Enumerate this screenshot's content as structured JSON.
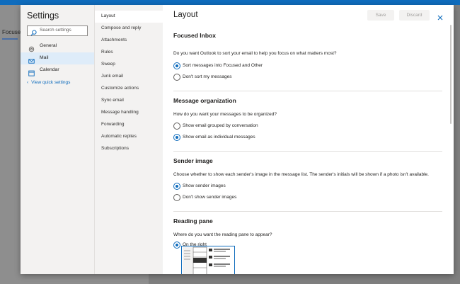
{
  "background": {
    "focused_label": "Focused"
  },
  "dialog": {
    "title": "Settings",
    "search": {
      "placeholder": "Search settings"
    },
    "categories": [
      {
        "label": "General",
        "icon": "gear-icon"
      },
      {
        "label": "Mail",
        "icon": "mail-icon",
        "selected": true
      },
      {
        "label": "Calendar",
        "icon": "calendar-icon"
      }
    ],
    "view_quick_settings": "View quick settings",
    "subnav": [
      {
        "label": "Layout",
        "selected": true
      },
      {
        "label": "Compose and reply"
      },
      {
        "label": "Attachments"
      },
      {
        "label": "Rules"
      },
      {
        "label": "Sweep"
      },
      {
        "label": "Junk email"
      },
      {
        "label": "Customize actions"
      },
      {
        "label": "Sync email"
      },
      {
        "label": "Message handling"
      },
      {
        "label": "Forwarding"
      },
      {
        "label": "Automatic replies"
      },
      {
        "label": "Subscriptions"
      }
    ],
    "pane": {
      "title": "Layout",
      "save_label": "Save",
      "discard_label": "Discard",
      "sections": [
        {
          "heading": "Focused Inbox",
          "question": "Do you want Outlook to sort your email to help you focus on what matters most?",
          "options": [
            {
              "label": "Sort messages into Focused and Other",
              "checked": true
            },
            {
              "label": "Don't sort my messages",
              "checked": false
            }
          ]
        },
        {
          "heading": "Message organization",
          "question": "How do you want your messages to be organized?",
          "options": [
            {
              "label": "Show email grouped by conversation",
              "checked": false
            },
            {
              "label": "Show email as individual messages",
              "checked": true
            }
          ]
        },
        {
          "heading": "Sender image",
          "question": "Choose whether to show each sender's image in the message list. The sender's initials will be shown if a photo isn't available.",
          "options": [
            {
              "label": "Show sender images",
              "checked": true
            },
            {
              "label": "Don't show sender images",
              "checked": false
            }
          ]
        },
        {
          "heading": "Reading pane",
          "question": "Where do you want the reading pane to appear?",
          "options": [
            {
              "label": "On the right",
              "checked": true
            }
          ]
        }
      ]
    }
  },
  "colors": {
    "accent": "#0f6cbd",
    "selected_bg": "#deecf9",
    "nav_bg": "#f3f2f1"
  }
}
